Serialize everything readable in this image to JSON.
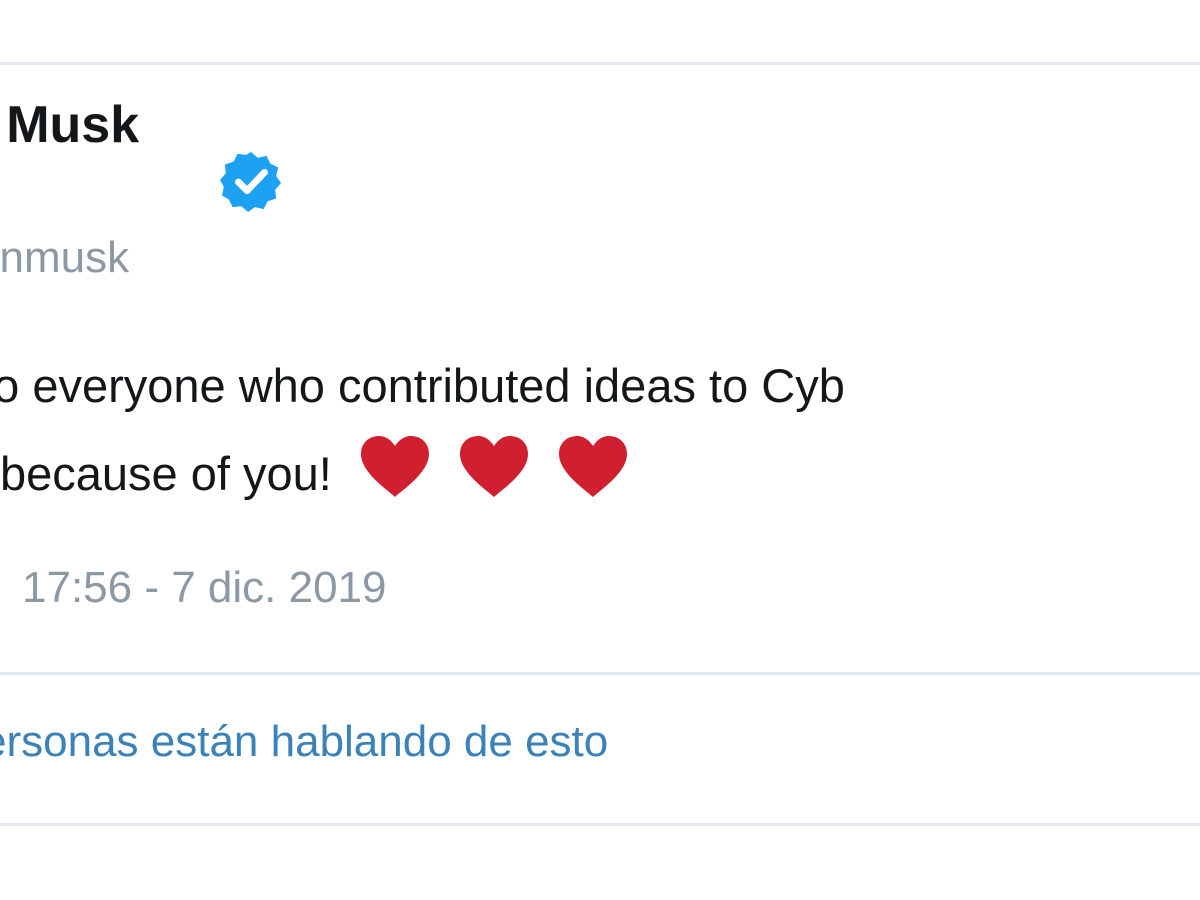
{
  "tweet": {
    "author_name": "n Musk",
    "handle": "onmusk",
    "text_line_1": "ks to everyone who contributed ideas to Cyb",
    "text_line_2": "because of you!",
    "hearts": [
      "heart-icon",
      "heart-icon",
      "heart-icon"
    ],
    "timestamp": "17:56 - 7 dic. 2019",
    "conversation_link": "ersonas están hablando de esto"
  },
  "colors": {
    "verified_badge": "#1da1f2",
    "heart": "#d0202f",
    "link": "#3b82b8",
    "muted_text": "#8c98a3",
    "primary_text": "#14171a",
    "border": "#e1e8ed"
  }
}
